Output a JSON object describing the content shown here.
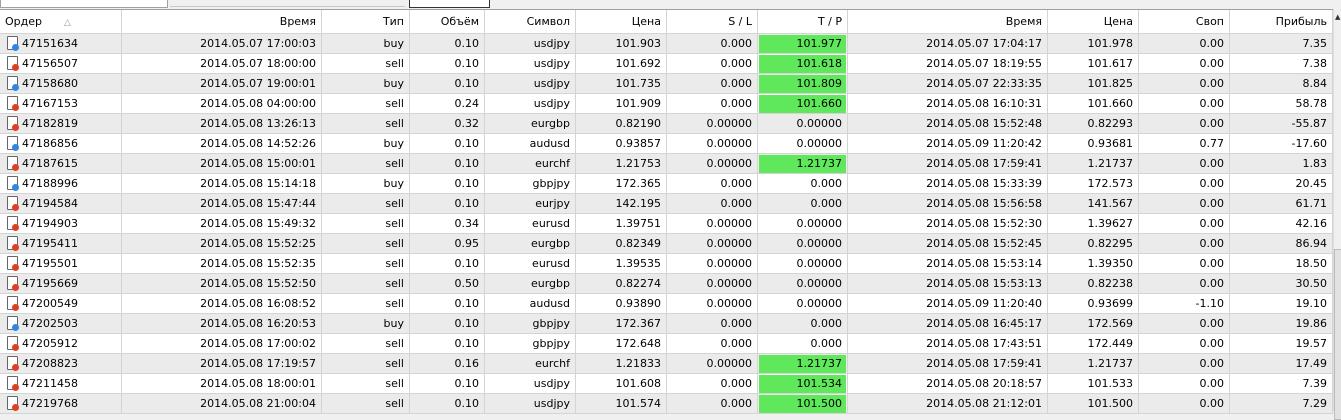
{
  "colors": {
    "tp_highlight": "#5fe85c",
    "buy_icon": "#2f88e0",
    "sell_icon": "#e0401f"
  },
  "columns": [
    "Ордер",
    "Время",
    "Тип",
    "Объём",
    "Символ",
    "Цена",
    "S / L",
    "T / P",
    "Время",
    "Цена",
    "Своп",
    "Прибыль"
  ],
  "rows": [
    {
      "order": "47151634",
      "open_time": "2014.05.07 17:00:03",
      "type": "buy",
      "volume": "0.10",
      "symbol": "usdjpy",
      "open_price": "101.903",
      "sl": "0.000",
      "tp": "101.977",
      "tp_hit": true,
      "close_time": "2014.05.07 17:04:17",
      "close_price": "101.978",
      "swap": "0.00",
      "profit": "7.35"
    },
    {
      "order": "47156507",
      "open_time": "2014.05.07 18:00:00",
      "type": "sell",
      "volume": "0.10",
      "symbol": "usdjpy",
      "open_price": "101.692",
      "sl": "0.000",
      "tp": "101.618",
      "tp_hit": true,
      "close_time": "2014.05.07 18:19:55",
      "close_price": "101.617",
      "swap": "0.00",
      "profit": "7.38"
    },
    {
      "order": "47158680",
      "open_time": "2014.05.07 19:00:01",
      "type": "buy",
      "volume": "0.10",
      "symbol": "usdjpy",
      "open_price": "101.735",
      "sl": "0.000",
      "tp": "101.809",
      "tp_hit": true,
      "close_time": "2014.05.07 22:33:35",
      "close_price": "101.825",
      "swap": "0.00",
      "profit": "8.84"
    },
    {
      "order": "47167153",
      "open_time": "2014.05.08 04:00:00",
      "type": "sell",
      "volume": "0.24",
      "symbol": "usdjpy",
      "open_price": "101.909",
      "sl": "0.000",
      "tp": "101.660",
      "tp_hit": true,
      "close_time": "2014.05.08 16:10:31",
      "close_price": "101.660",
      "swap": "0.00",
      "profit": "58.78"
    },
    {
      "order": "47182819",
      "open_time": "2014.05.08 13:26:13",
      "type": "sell",
      "volume": "0.32",
      "symbol": "eurgbp",
      "open_price": "0.82190",
      "sl": "0.00000",
      "tp": "0.00000",
      "tp_hit": false,
      "close_time": "2014.05.08 15:52:48",
      "close_price": "0.82293",
      "swap": "0.00",
      "profit": "-55.87"
    },
    {
      "order": "47186856",
      "open_time": "2014.05.08 14:52:26",
      "type": "buy",
      "volume": "0.10",
      "symbol": "audusd",
      "open_price": "0.93857",
      "sl": "0.00000",
      "tp": "0.00000",
      "tp_hit": false,
      "close_time": "2014.05.09 11:20:42",
      "close_price": "0.93681",
      "swap": "0.77",
      "profit": "-17.60"
    },
    {
      "order": "47187615",
      "open_time": "2014.05.08 15:00:01",
      "type": "sell",
      "volume": "0.10",
      "symbol": "eurchf",
      "open_price": "1.21753",
      "sl": "0.00000",
      "tp": "1.21737",
      "tp_hit": true,
      "close_time": "2014.05.08 17:59:41",
      "close_price": "1.21737",
      "swap": "0.00",
      "profit": "1.83"
    },
    {
      "order": "47188996",
      "open_time": "2014.05.08 15:14:18",
      "type": "buy",
      "volume": "0.10",
      "symbol": "gbpjpy",
      "open_price": "172.365",
      "sl": "0.000",
      "tp": "0.000",
      "tp_hit": false,
      "close_time": "2014.05.08 15:33:39",
      "close_price": "172.573",
      "swap": "0.00",
      "profit": "20.45"
    },
    {
      "order": "47194584",
      "open_time": "2014.05.08 15:47:44",
      "type": "sell",
      "volume": "0.10",
      "symbol": "eurjpy",
      "open_price": "142.195",
      "sl": "0.000",
      "tp": "0.000",
      "tp_hit": false,
      "close_time": "2014.05.08 15:56:58",
      "close_price": "141.567",
      "swap": "0.00",
      "profit": "61.71"
    },
    {
      "order": "47194903",
      "open_time": "2014.05.08 15:49:32",
      "type": "sell",
      "volume": "0.34",
      "symbol": "eurusd",
      "open_price": "1.39751",
      "sl": "0.00000",
      "tp": "0.00000",
      "tp_hit": false,
      "close_time": "2014.05.08 15:52:30",
      "close_price": "1.39627",
      "swap": "0.00",
      "profit": "42.16"
    },
    {
      "order": "47195411",
      "open_time": "2014.05.08 15:52:25",
      "type": "sell",
      "volume": "0.95",
      "symbol": "eurgbp",
      "open_price": "0.82349",
      "sl": "0.00000",
      "tp": "0.00000",
      "tp_hit": false,
      "close_time": "2014.05.08 15:52:45",
      "close_price": "0.82295",
      "swap": "0.00",
      "profit": "86.94"
    },
    {
      "order": "47195501",
      "open_time": "2014.05.08 15:52:35",
      "type": "sell",
      "volume": "0.10",
      "symbol": "eurusd",
      "open_price": "1.39535",
      "sl": "0.00000",
      "tp": "0.00000",
      "tp_hit": false,
      "close_time": "2014.05.08 15:53:14",
      "close_price": "1.39350",
      "swap": "0.00",
      "profit": "18.50"
    },
    {
      "order": "47195669",
      "open_time": "2014.05.08 15:52:50",
      "type": "sell",
      "volume": "0.50",
      "symbol": "eurgbp",
      "open_price": "0.82274",
      "sl": "0.00000",
      "tp": "0.00000",
      "tp_hit": false,
      "close_time": "2014.05.08 15:53:13",
      "close_price": "0.82238",
      "swap": "0.00",
      "profit": "30.50"
    },
    {
      "order": "47200549",
      "open_time": "2014.05.08 16:08:52",
      "type": "sell",
      "volume": "0.10",
      "symbol": "audusd",
      "open_price": "0.93890",
      "sl": "0.00000",
      "tp": "0.00000",
      "tp_hit": false,
      "close_time": "2014.05.09 11:20:40",
      "close_price": "0.93699",
      "swap": "-1.10",
      "profit": "19.10"
    },
    {
      "order": "47202503",
      "open_time": "2014.05.08 16:20:53",
      "type": "buy",
      "volume": "0.10",
      "symbol": "gbpjpy",
      "open_price": "172.367",
      "sl": "0.000",
      "tp": "0.000",
      "tp_hit": false,
      "close_time": "2014.05.08 16:45:17",
      "close_price": "172.569",
      "swap": "0.00",
      "profit": "19.86"
    },
    {
      "order": "47205912",
      "open_time": "2014.05.08 17:00:02",
      "type": "sell",
      "volume": "0.10",
      "symbol": "gbpjpy",
      "open_price": "172.648",
      "sl": "0.000",
      "tp": "0.000",
      "tp_hit": false,
      "close_time": "2014.05.08 17:43:51",
      "close_price": "172.449",
      "swap": "0.00",
      "profit": "19.57"
    },
    {
      "order": "47208823",
      "open_time": "2014.05.08 17:19:57",
      "type": "sell",
      "volume": "0.16",
      "symbol": "eurchf",
      "open_price": "1.21833",
      "sl": "0.00000",
      "tp": "1.21737",
      "tp_hit": true,
      "close_time": "2014.05.08 17:59:41",
      "close_price": "1.21737",
      "swap": "0.00",
      "profit": "17.49"
    },
    {
      "order": "47211458",
      "open_time": "2014.05.08 18:00:01",
      "type": "sell",
      "volume": "0.10",
      "symbol": "usdjpy",
      "open_price": "101.608",
      "sl": "0.000",
      "tp": "101.534",
      "tp_hit": true,
      "close_time": "2014.05.08 20:18:57",
      "close_price": "101.533",
      "swap": "0.00",
      "profit": "7.39"
    },
    {
      "order": "47219768",
      "open_time": "2014.05.08 21:00:04",
      "type": "sell",
      "volume": "0.10",
      "symbol": "usdjpy",
      "open_price": "101.574",
      "sl": "0.000",
      "tp": "101.500",
      "tp_hit": true,
      "close_time": "2014.05.08 21:12:01",
      "close_price": "101.500",
      "swap": "0.00",
      "profit": "7.29"
    }
  ]
}
